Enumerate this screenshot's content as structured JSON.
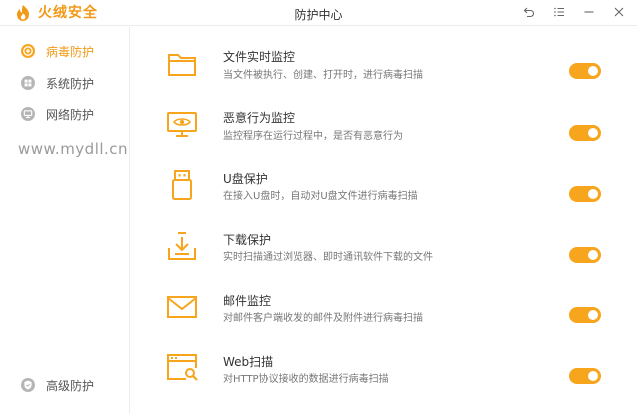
{
  "app": {
    "brand_name": "火绒安全",
    "window_title": "防护中心"
  },
  "colors": {
    "accent": "#f7a51c",
    "brand": "#f29a17",
    "sidebar_icon": "#b5b5b5"
  },
  "window_buttons": [
    {
      "name": "back-icon"
    },
    {
      "name": "menu-icon"
    },
    {
      "name": "minimize-icon"
    },
    {
      "name": "close-icon"
    }
  ],
  "sidebar": {
    "items": [
      {
        "label": "病毒防护",
        "icon": "virus-shield-icon",
        "active": true
      },
      {
        "label": "系统防护",
        "icon": "windows-icon",
        "active": false
      },
      {
        "label": "网络防护",
        "icon": "network-icon",
        "active": false
      }
    ],
    "watermark": "www.mydll.cn",
    "bottom_item": {
      "label": "高级防护",
      "icon": "advanced-shield-icon"
    }
  },
  "features": [
    {
      "title": "文件实时监控",
      "desc": "当文件被执行、创建、打开时，进行病毒扫描",
      "icon": "folder-icon",
      "enabled": true
    },
    {
      "title": "恶意行为监控",
      "desc": "监控程序在运行过程中，是否有恶意行为",
      "icon": "monitor-eye-icon",
      "enabled": true
    },
    {
      "title": "U盘保护",
      "desc": "在接入U盘时，自动对U盘文件进行病毒扫描",
      "icon": "usb-drive-icon",
      "enabled": true
    },
    {
      "title": "下载保护",
      "desc": "实时扫描通过浏览器、即时通讯软件下载的文件",
      "icon": "download-icon",
      "enabled": true
    },
    {
      "title": "邮件监控",
      "desc": "对邮件客户端收发的邮件及附件进行病毒扫描",
      "icon": "mail-icon",
      "enabled": true
    },
    {
      "title": "Web扫描",
      "desc": "对HTTP协议接收的数据进行病毒扫描",
      "icon": "web-scan-icon",
      "enabled": true
    }
  ]
}
